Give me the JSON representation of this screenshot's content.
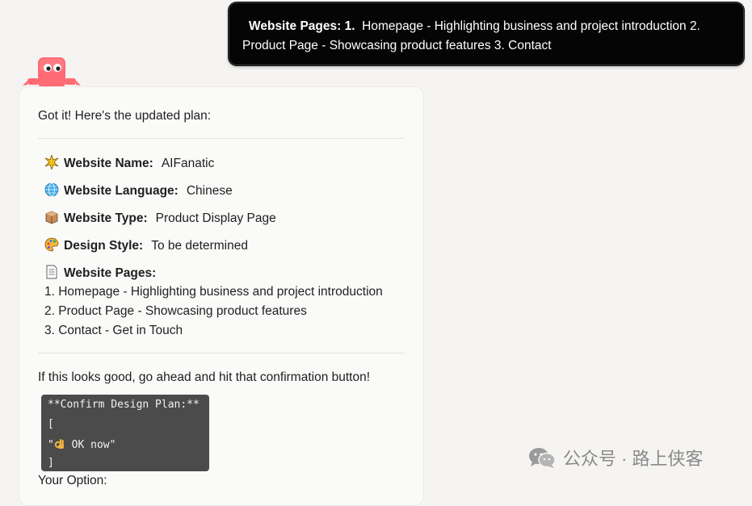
{
  "user_message": {
    "label": "Website Pages: 1.",
    "line1_rest": "Homepage - Highlighting business and project introduction 2.",
    "line2": "Product Page - Showcasing product features 3. Contact"
  },
  "assistant": {
    "intro": "Got it! Here's the updated plan:",
    "plan": [
      {
        "icon": "sparkle-icon",
        "label": "Website Name:",
        "value": "AIFanatic"
      },
      {
        "icon": "globe-icon",
        "label": "Website Language:",
        "value": "Chinese"
      },
      {
        "icon": "box-icon",
        "label": "Website Type:",
        "value": "Product Display Page"
      },
      {
        "icon": "palette-icon",
        "label": "Design Style:",
        "value": "To be determined"
      }
    ],
    "pages": {
      "icon": "document-icon",
      "label": "Website Pages:",
      "items": [
        "1. Homepage - Highlighting business and project introduction",
        "2. Product Page - Showcasing product features",
        "3. Contact - Get in Touch"
      ]
    },
    "prompt": "If this looks good, go ahead and hit that confirmation button!",
    "code": {
      "line1": "**Confirm Design Plan:**",
      "line2": "[",
      "line3_pre": "\"",
      "line3_icon": "ok-hand-icon",
      "line3_post": " OK now\"",
      "line4": "]"
    },
    "your_option": "Your Option:"
  },
  "watermark": {
    "icon": "wechat-icon",
    "text": "公众号 · 路上侠客"
  },
  "colors": {
    "background": "#f5f4f2",
    "user_bubble": "#050505",
    "card": "#fafaf9",
    "code_bg": "#4b4b4b",
    "mascot": "#ff6b75"
  }
}
